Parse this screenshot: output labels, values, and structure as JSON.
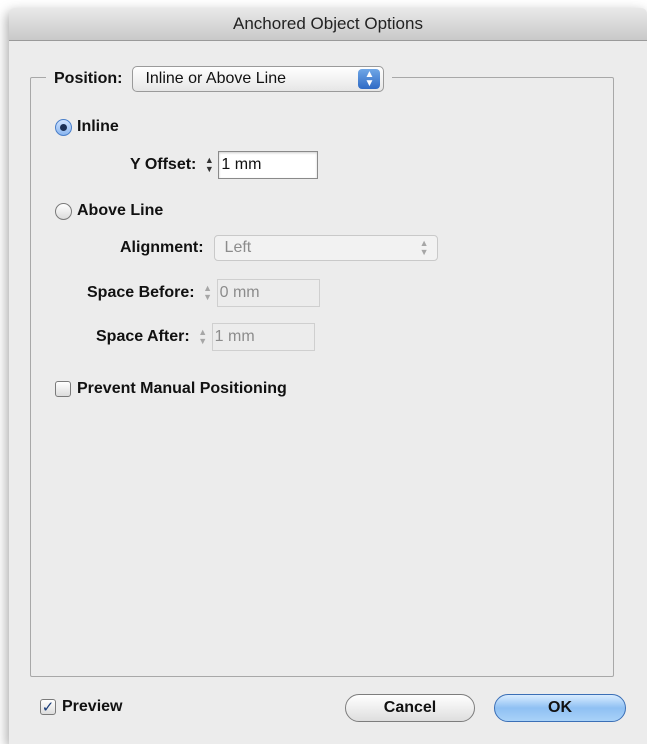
{
  "window": {
    "title": "Anchored Object Options"
  },
  "position": {
    "label": "Position:",
    "value": "Inline or Above Line"
  },
  "inline": {
    "label": "Inline",
    "selected": true,
    "y_offset_label": "Y Offset:",
    "y_offset_value": "1 mm"
  },
  "above_line": {
    "label": "Above Line",
    "selected": false,
    "alignment_label": "Alignment:",
    "alignment_value": "Left",
    "space_before_label": "Space Before:",
    "space_before_value": "0 mm",
    "space_after_label": "Space After:",
    "space_after_value": "1 mm"
  },
  "prevent_manual_positioning": {
    "label": "Prevent Manual Positioning",
    "checked": false
  },
  "footer": {
    "preview_label": "Preview",
    "preview_checked": true,
    "cancel_label": "Cancel",
    "ok_label": "OK"
  },
  "colors": {
    "default_button": "#8fc0f3",
    "popup_arrows": "#2f6ac5",
    "dialog_bg": "#ececec"
  },
  "icons": {
    "up_down_arrows": "stepper-arrows-icon",
    "checkmark": "checkmark-icon"
  }
}
